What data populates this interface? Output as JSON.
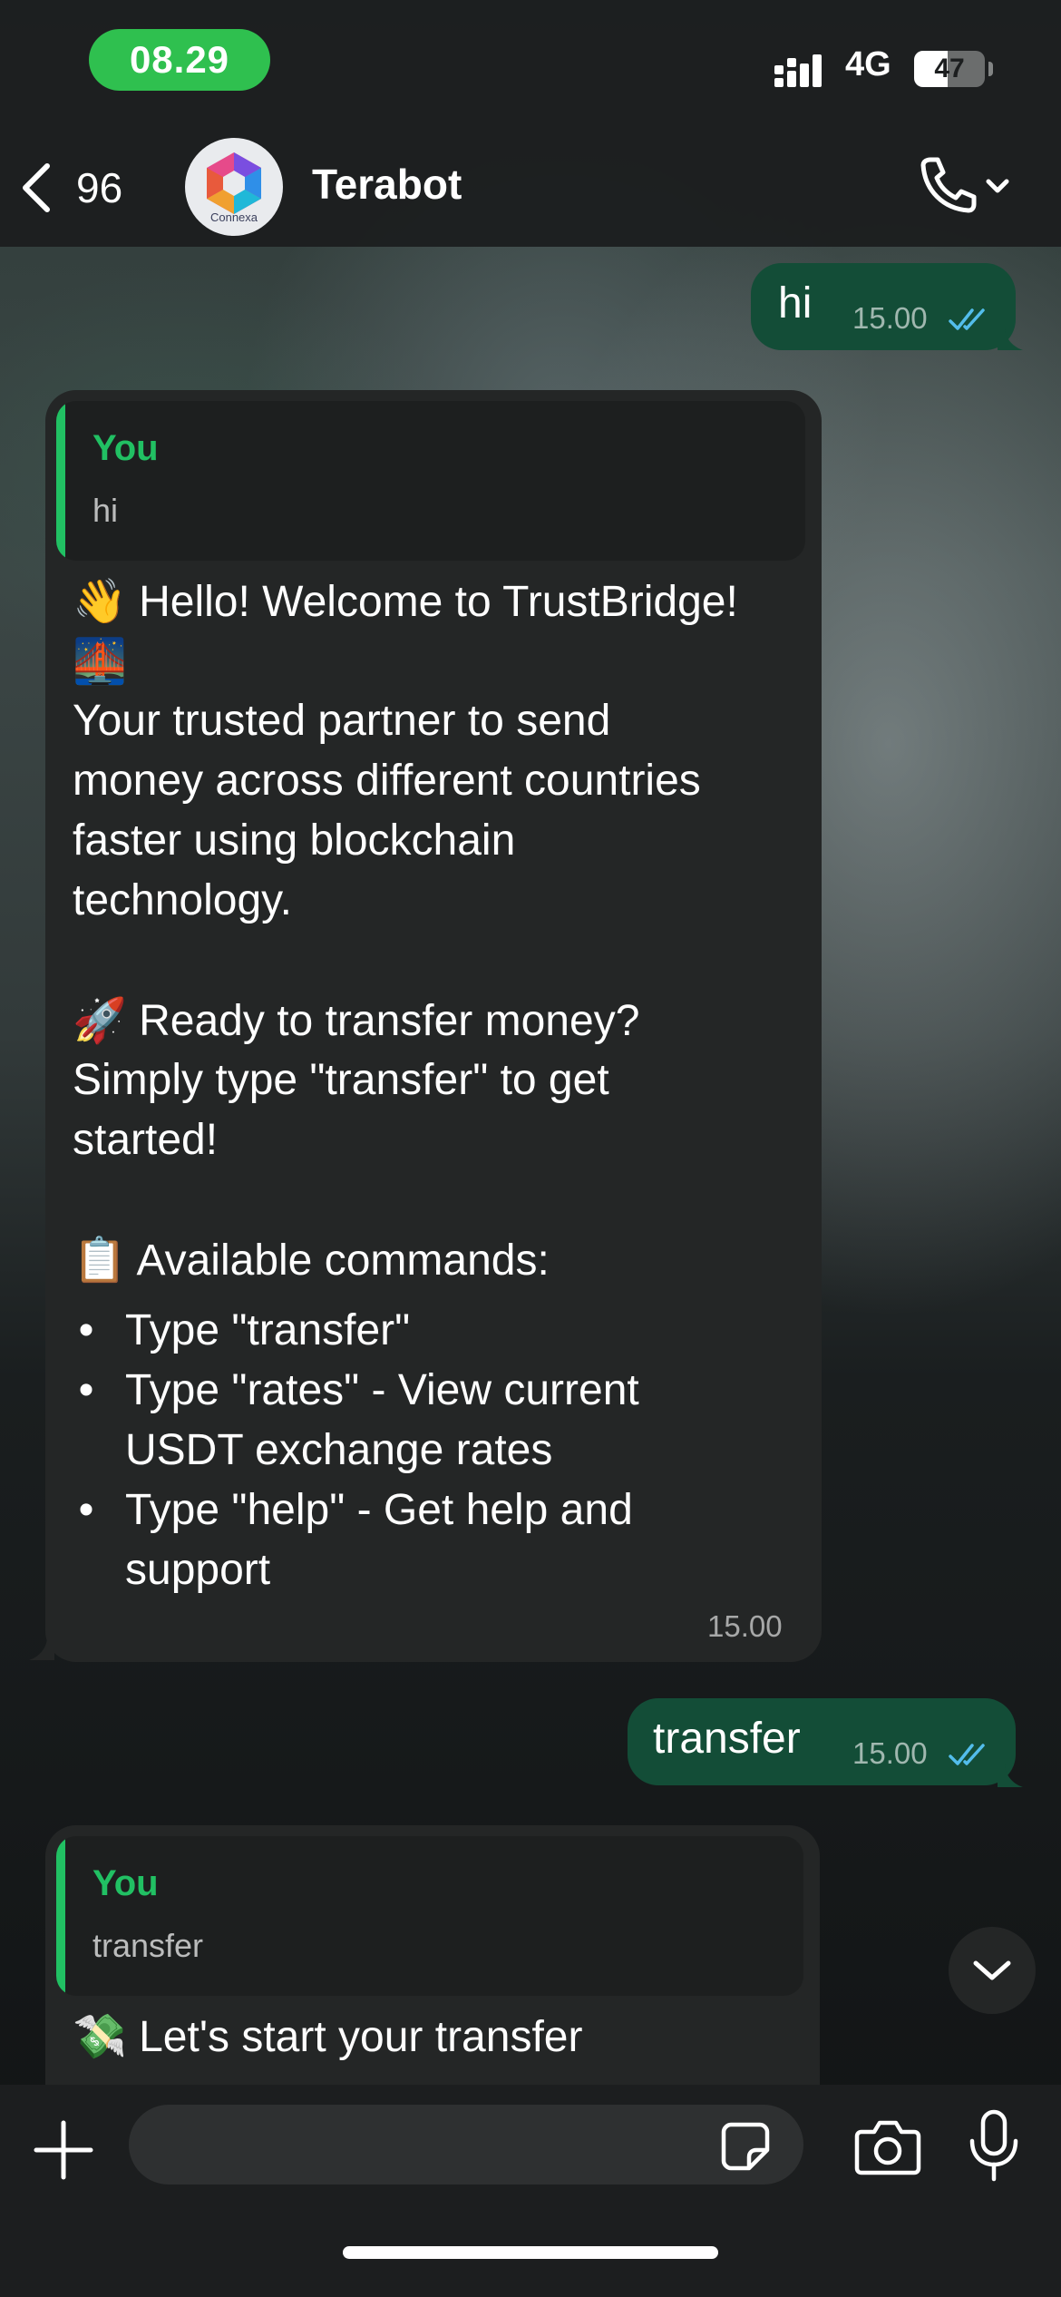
{
  "status_bar": {
    "time": "08.29",
    "network": "4G",
    "battery": "47",
    "battery_level": 0.47
  },
  "header": {
    "back_count": "96",
    "contact_name": "Terabot",
    "avatar_caption": "Connexa"
  },
  "messages": [
    {
      "direction": "out",
      "text": "hi",
      "time": "15.00"
    },
    {
      "direction": "in",
      "quote": {
        "author": "You",
        "text": "hi"
      },
      "lines": [
        "Hello! Welcome to TrustBridge!",
        "Your trusted partner to send",
        "money across different countries",
        "faster using blockchain",
        "technology.",
        "Ready to transfer money?",
        "Simply type \"transfer\" to get",
        "started!",
        "Available commands:"
      ],
      "list": [
        [
          "Type \"transfer\""
        ],
        [
          "Type \"rates\" - View current",
          "USDT exchange rates"
        ],
        [
          "Type \"help\" - Get help and",
          "support"
        ]
      ],
      "time": "15.00"
    },
    {
      "direction": "out",
      "text": "transfer",
      "time": "15.00"
    },
    {
      "direction": "in",
      "quote": {
        "author": "You",
        "text": "transfer"
      },
      "lines": [
        "Let's start your transfer"
      ]
    }
  ],
  "emojis": {
    "wave": "👋",
    "bridge": "🌉",
    "rocket": "🚀",
    "clipboard": "📋",
    "money": "💸"
  },
  "composer": {
    "placeholder": ""
  },
  "colors": {
    "accent_green": "#21c063",
    "outgoing_bubble": "#134d37",
    "incoming_bubble": "#242626",
    "read_ticks": "#53bdeb",
    "time_pill": "#2fc04f"
  }
}
